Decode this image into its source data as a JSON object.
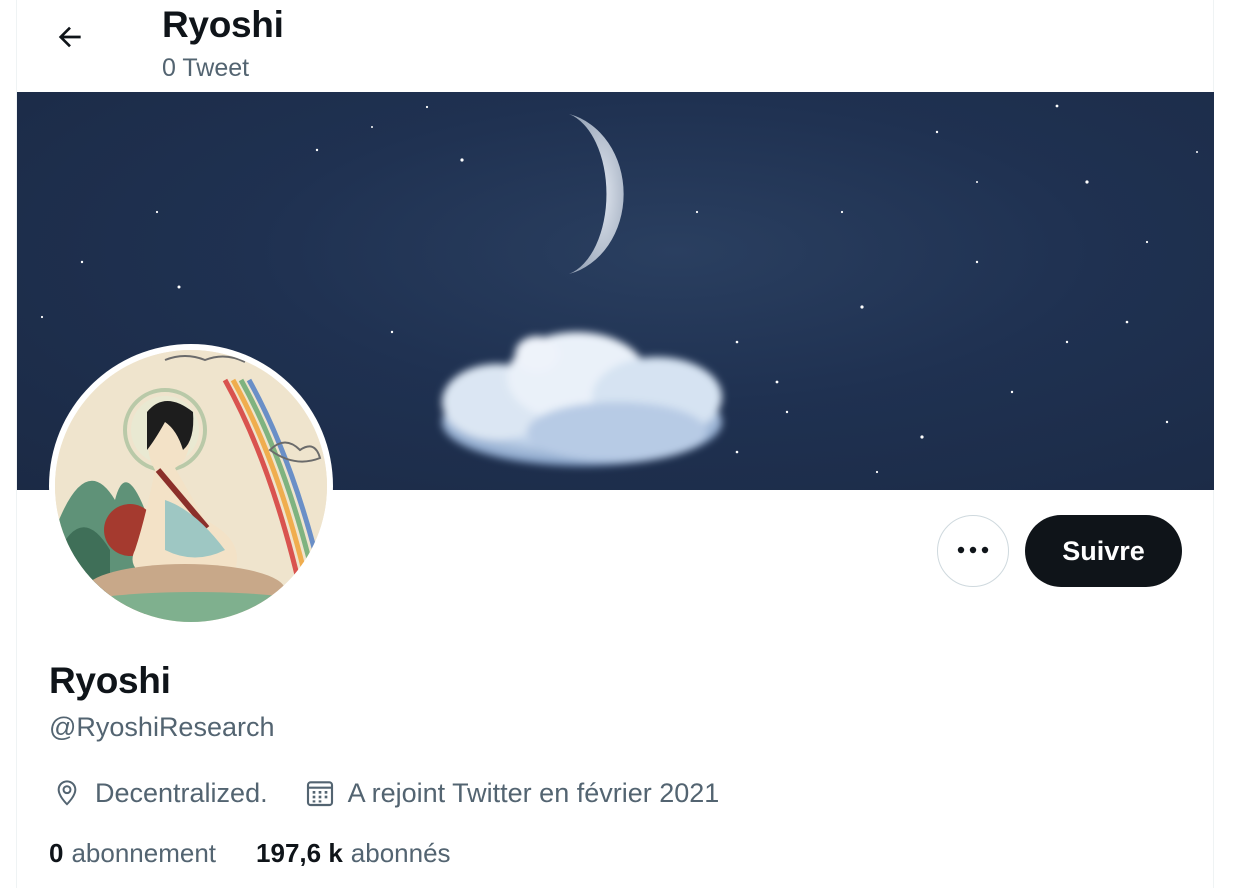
{
  "header": {
    "title": "Ryoshi",
    "tweet_count": "0 Tweet"
  },
  "profile": {
    "display_name": "Ryoshi",
    "handle": "@RyoshiResearch",
    "location": "Decentralized.",
    "joined": "A rejoint Twitter en février 2021",
    "follow_button": "Suivre",
    "more_button": "•••"
  },
  "stats": {
    "following_count": "0",
    "following_label": "abonnement",
    "followers_count": "197,6 k",
    "followers_label": "abonnés"
  },
  "icons": {
    "back": "arrow-left-icon",
    "more": "ellipsis-icon",
    "location": "location-pin-icon",
    "calendar": "calendar-icon"
  },
  "colors": {
    "text_primary": "#0f1419",
    "text_secondary": "#536471",
    "button_dark": "#0f1419",
    "border": "#cfd9de",
    "banner_sky": "#1f3151"
  }
}
